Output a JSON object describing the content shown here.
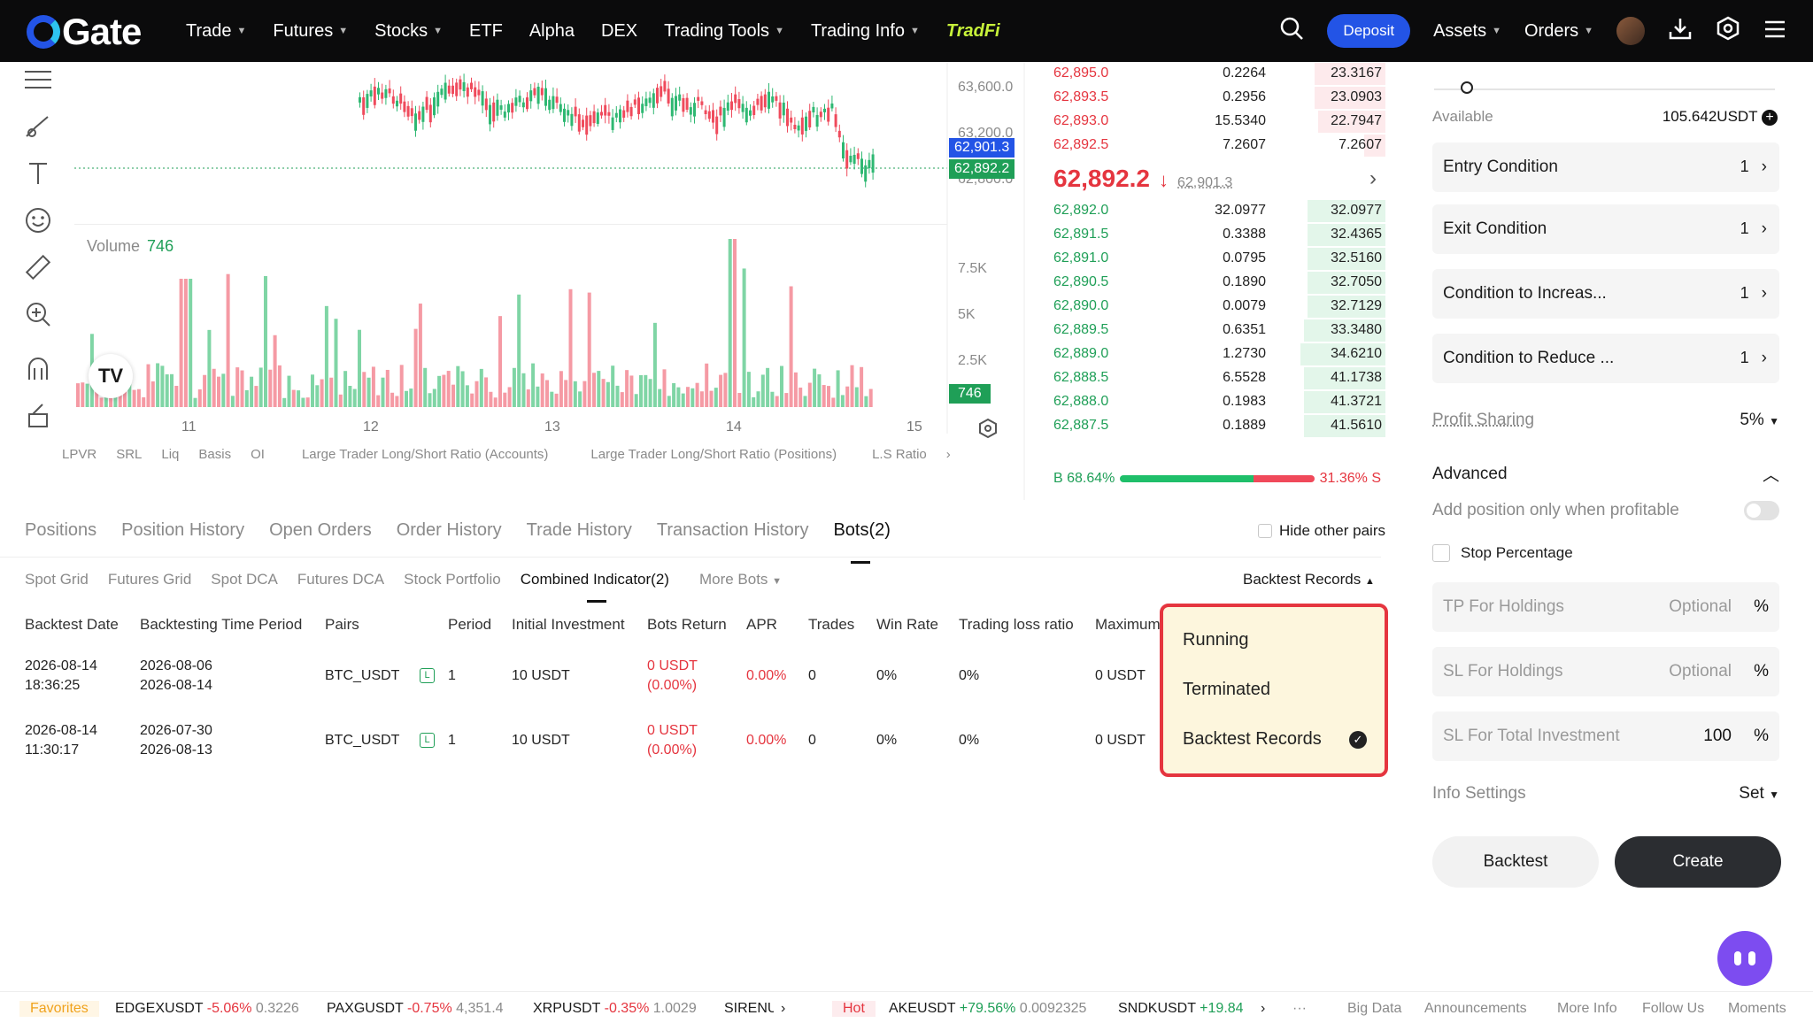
{
  "nav": {
    "logo_text": "Gate",
    "items": [
      {
        "label": "Trade",
        "caret": true
      },
      {
        "label": "Futures",
        "caret": true
      },
      {
        "label": "Stocks",
        "caret": true
      },
      {
        "label": "ETF",
        "caret": false
      },
      {
        "label": "Alpha",
        "caret": false
      },
      {
        "label": "DEX",
        "caret": false
      },
      {
        "label": "Trading Tools",
        "caret": true
      },
      {
        "label": "Trading Info",
        "caret": true
      }
    ],
    "tradfi_label": "TradFi",
    "deposit_label": "Deposit",
    "assets_label": "Assets",
    "orders_label": "Orders"
  },
  "chart": {
    "price_ticks": [
      "63,600.0",
      "63,200.0"
    ],
    "price_badge_last": "62,901.3",
    "price_badge_mark": "62,892.2",
    "price_tick_below": "62,800.0",
    "volume_label": "Volume",
    "volume_value": "746",
    "volume_ticks": [
      "7.5K",
      "5K",
      "2.5K"
    ],
    "volume_badge": "746",
    "x_labels": [
      "11",
      "12",
      "13",
      "14",
      "15"
    ],
    "indicators": [
      "LPVR",
      "SRL",
      "Liq",
      "Basis",
      "OI",
      "Large Trader Long/Short Ratio (Accounts)",
      "Large Trader Long/Short Ratio (Positions)",
      "L.S Ratio"
    ],
    "tv_logo": "TV"
  },
  "orderbook": {
    "asks": [
      {
        "price": "62,895.0",
        "amount": "0.2264",
        "total": "23.3167",
        "depth": 0.2
      },
      {
        "price": "62,893.5",
        "amount": "0.2956",
        "total": "23.0903",
        "depth": 0.2
      },
      {
        "price": "62,893.0",
        "amount": "15.5340",
        "total": "22.7947",
        "depth": 0.19
      },
      {
        "price": "62,892.5",
        "amount": "7.2607",
        "total": "7.2607",
        "depth": 0.06
      }
    ],
    "mid_price": "62,892.2",
    "mid_arrow": "↓",
    "mid_sub": "62,901.3",
    "bids": [
      {
        "price": "62,892.0",
        "amount": "32.0977",
        "total": "32.0977",
        "depth": 0.22
      },
      {
        "price": "62,891.5",
        "amount": "0.3388",
        "total": "32.4365",
        "depth": 0.22
      },
      {
        "price": "62,891.0",
        "amount": "0.0795",
        "total": "32.5160",
        "depth": 0.22
      },
      {
        "price": "62,890.5",
        "amount": "0.1890",
        "total": "32.7050",
        "depth": 0.22
      },
      {
        "price": "62,890.0",
        "amount": "0.0079",
        "total": "32.7129",
        "depth": 0.22
      },
      {
        "price": "62,889.5",
        "amount": "0.6351",
        "total": "33.3480",
        "depth": 0.23
      },
      {
        "price": "62,889.0",
        "amount": "1.2730",
        "total": "34.6210",
        "depth": 0.24
      },
      {
        "price": "62,888.5",
        "amount": "6.5528",
        "total": "41.1738",
        "depth": 0.23
      },
      {
        "price": "62,888.0",
        "amount": "0.1983",
        "total": "41.3721",
        "depth": 0.23
      },
      {
        "price": "62,887.5",
        "amount": "0.1889",
        "total": "41.5610",
        "depth": 0.23
      }
    ],
    "buy_ratio_label": "B 68.64%",
    "sell_ratio_label": "31.36% S",
    "buy_ratio": 68.64
  },
  "right": {
    "available_label": "Available",
    "available_value": "105.642USDT",
    "conditions": [
      {
        "label": "Entry Condition",
        "count": "1"
      },
      {
        "label": "Exit Condition",
        "count": "1"
      },
      {
        "label": "Condition to Increas...",
        "count": "1"
      },
      {
        "label": "Condition to Reduce ...",
        "count": "1"
      }
    ],
    "profit_sharing_label": "Profit Sharing",
    "profit_sharing_value": "5%",
    "advanced_label": "Advanced",
    "add_position_label": "Add position only when profitable",
    "stop_percentage_label": "Stop Percentage",
    "tp_label": "TP For Holdings",
    "tp_placeholder": "Optional",
    "sl_label": "SL For Holdings",
    "sl_placeholder": "Optional",
    "sl_total_label": "SL For Total Investment",
    "sl_total_value": "100",
    "percent_unit": "%",
    "info_settings_label": "Info Settings",
    "info_settings_value": "Set",
    "backtest_label": "Backtest",
    "create_label": "Create"
  },
  "bottom": {
    "tabs": [
      "Positions",
      "Position History",
      "Open Orders",
      "Order History",
      "Trade History",
      "Transaction History",
      "Bots(2)"
    ],
    "hide_pairs_label": "Hide other pairs",
    "subtabs": [
      "Spot Grid",
      "Futures Grid",
      "Spot DCA",
      "Futures DCA",
      "Stock Portfolio",
      "Combined Indicator(2)",
      "More Bots"
    ],
    "backtest_records_label": "Backtest Records",
    "columns": [
      "Backtest Date",
      "Backtesting Time Period",
      "Pairs",
      "Period",
      "Initial Investment",
      "Bots Return",
      "APR",
      "Trades",
      "Win Rate",
      "Trading loss ratio",
      "Maximum"
    ],
    "rows": [
      {
        "date1": "2026-08-14",
        "date2": "18:36:25",
        "period1": "2026-08-06",
        "period2": "2026-08-14",
        "pair": "BTC_USDT",
        "pair_tag": "L",
        "period": "1",
        "investment": "10 USDT",
        "ret1": "0 USDT",
        "ret2": "(0.00%)",
        "apr": "0.00%",
        "trades": "0",
        "win": "0%",
        "loss": "0%",
        "max": "0 USDT"
      },
      {
        "date1": "2026-08-14",
        "date2": "11:30:17",
        "period1": "2026-07-30",
        "period2": "2026-08-13",
        "pair": "BTC_USDT",
        "pair_tag": "L",
        "period": "1",
        "investment": "10 USDT",
        "ret1": "0 USDT",
        "ret2": "(0.00%)",
        "apr": "0.00%",
        "trades": "0",
        "win": "0%",
        "loss": "0%",
        "max": "0 USDT"
      }
    ],
    "dropdown": [
      "Running",
      "Terminated",
      "Backtest Records"
    ]
  },
  "footer": {
    "favorites": "Favorites",
    "tickers": [
      {
        "sym": "EDGEXUSDT",
        "chg": "-5.06%",
        "price": "0.3226",
        "up": false
      },
      {
        "sym": "PAXGUSDT",
        "chg": "-0.75%",
        "price": "4,351.4",
        "up": false
      },
      {
        "sym": "XRPUSDT",
        "chg": "-0.35%",
        "price": "1.0029",
        "up": false
      }
    ],
    "trunc_sym": "SIRENU",
    "hot": "Hot",
    "hot_tickers": [
      {
        "sym": "AKEUSDT",
        "chg": "+79.56%",
        "price": "0.0092325",
        "up": true
      },
      {
        "sym": "SNDKUSDT",
        "chg": "+19.84",
        "price": "",
        "up": true
      }
    ],
    "links": [
      "Big Data",
      "Announcements",
      "More Info",
      "Follow Us",
      "Moments"
    ]
  },
  "colors": {
    "up": "#1f9f57",
    "down": "#e5353f",
    "brand": "#2354e6"
  }
}
